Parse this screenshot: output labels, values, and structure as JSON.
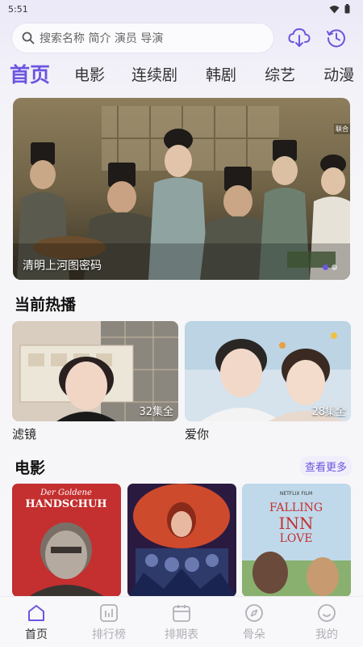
{
  "status": {
    "time": "5:51"
  },
  "search": {
    "placeholder": "搜索名称 简介 演员 导演"
  },
  "tabs": [
    {
      "label": "首页",
      "active": true
    },
    {
      "label": "电影"
    },
    {
      "label": "连续剧"
    },
    {
      "label": "韩剧"
    },
    {
      "label": "综艺"
    },
    {
      "label": "动漫"
    }
  ],
  "banner": {
    "title": "清明上河图密码",
    "corner_text": "联合",
    "slide_count": 2,
    "active_slide": 1
  },
  "hot": {
    "title": "当前热播",
    "items": [
      {
        "name": "滤镜",
        "episodes": "32集全"
      },
      {
        "name": "爱你",
        "episodes": "28集全"
      }
    ]
  },
  "movies": {
    "title": "电影",
    "more": "查看更多",
    "posters": [
      {
        "title_line1": "Der Goldene",
        "title_line2": "HANDSCHUH"
      },
      {
        "title_line1": ""
      },
      {
        "title_line1": "FALLING",
        "title_line2": "INN",
        "title_line3": "LOVE",
        "badge": "NETFLIX FILM"
      }
    ]
  },
  "nav": [
    {
      "label": "首页",
      "icon": "home-icon",
      "active": true
    },
    {
      "label": "排行榜",
      "icon": "chart-icon"
    },
    {
      "label": "排期表",
      "icon": "calendar-icon"
    },
    {
      "label": "骨朵",
      "icon": "compass-icon"
    },
    {
      "label": "我的",
      "icon": "smile-icon"
    }
  ],
  "colors": {
    "accent": "#6b56e0",
    "inactive": "#b0b0b8"
  }
}
